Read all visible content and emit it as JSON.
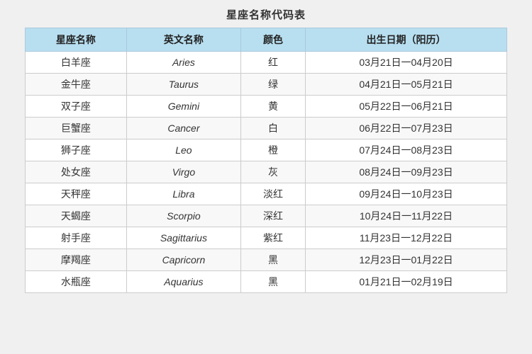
{
  "title": "星座名称代码表",
  "headers": [
    "星座名称",
    "英文名称",
    "颜色",
    "出生日期（阳历）"
  ],
  "rows": [
    {
      "chinese": "白羊座",
      "english": "Aries",
      "color": "红",
      "date": "03月21日一04月20日"
    },
    {
      "chinese": "金牛座",
      "english": "Taurus",
      "color": "绿",
      "date": "04月21日一05月21日"
    },
    {
      "chinese": "双子座",
      "english": "Gemini",
      "color": "黄",
      "date": "05月22日一06月21日"
    },
    {
      "chinese": "巨蟹座",
      "english": "Cancer",
      "color": "白",
      "date": "06月22日一07月23日"
    },
    {
      "chinese": "狮子座",
      "english": "Leo",
      "color": "橙",
      "date": "07月24日一08月23日"
    },
    {
      "chinese": "处女座",
      "english": "Virgo",
      "color": "灰",
      "date": "08月24日一09月23日"
    },
    {
      "chinese": "天秤座",
      "english": "Libra",
      "color": "淡红",
      "date": "09月24日一10月23日"
    },
    {
      "chinese": "天蝎座",
      "english": "Scorpio",
      "color": "深红",
      "date": "10月24日一11月22日"
    },
    {
      "chinese": "射手座",
      "english": "Sagittarius",
      "color": "紫红",
      "date": "11月23日一12月22日"
    },
    {
      "chinese": "摩羯座",
      "english": "Capricorn",
      "color": "黑",
      "date": "12月23日一01月22日"
    },
    {
      "chinese": "水瓶座",
      "english": "Aquarius",
      "color": "黑",
      "date": "01月21日一02月19日"
    }
  ]
}
